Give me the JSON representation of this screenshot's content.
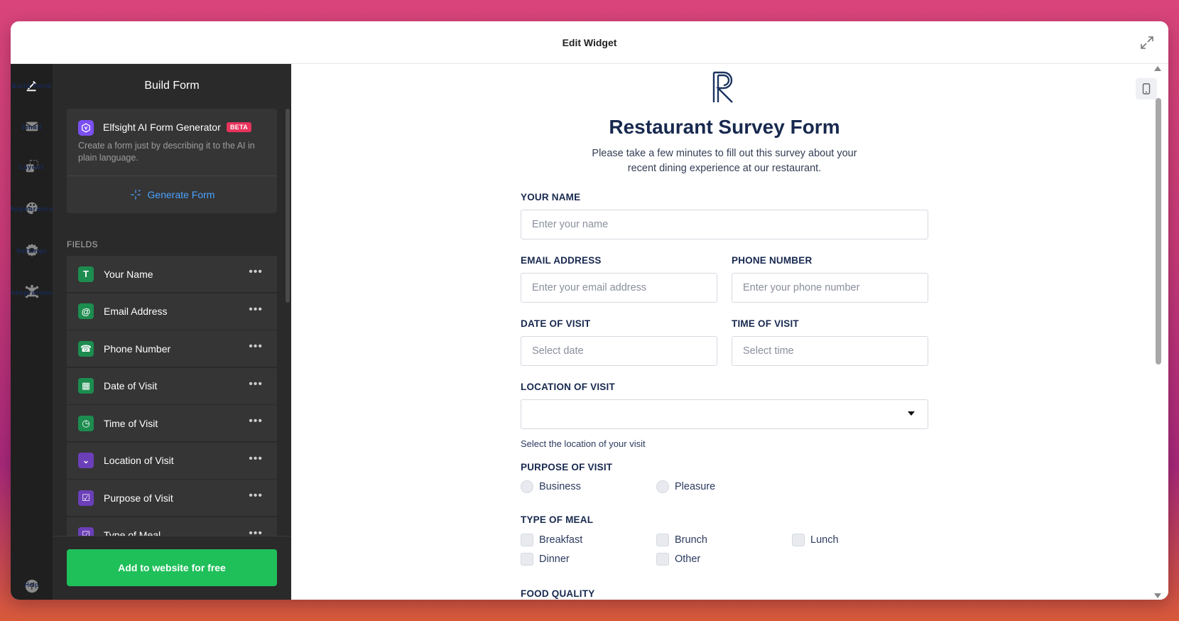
{
  "window": {
    "title": "Edit Widget"
  },
  "rail": {
    "items": [
      {
        "label": "Build Form",
        "icon": "pencil-icon"
      },
      {
        "label": "Email",
        "icon": "envelope-icon"
      },
      {
        "label": "Layout",
        "icon": "layout-icon"
      },
      {
        "label": "Appearance",
        "icon": "palette-icon"
      },
      {
        "label": "Settings",
        "icon": "gear-icon"
      },
      {
        "label": "Integrations",
        "icon": "integrations-icon"
      }
    ],
    "help_label": "Help"
  },
  "sidebar": {
    "title": "Build Form",
    "ai": {
      "name": "Elfsight AI Form Generator",
      "badge": "BETA",
      "description": "Create a form just by describing it to the AI in plain language.",
      "generate_label": "Generate Form"
    },
    "fields_label": "FIELDS",
    "fields": [
      {
        "name": "Your Name",
        "icon_glyph": "T",
        "color": "#1c8c4f"
      },
      {
        "name": "Email Address",
        "icon_glyph": "@",
        "color": "#1c8c4f"
      },
      {
        "name": "Phone Number",
        "icon_glyph": "☎",
        "color": "#1c8c4f"
      },
      {
        "name": "Date of Visit",
        "icon_glyph": "▦",
        "color": "#1c8c4f"
      },
      {
        "name": "Time of Visit",
        "icon_glyph": "◷",
        "color": "#1c8c4f"
      },
      {
        "name": "Location of Visit",
        "icon_glyph": "⌄",
        "color": "#6b3fb8"
      },
      {
        "name": "Purpose of Visit",
        "icon_glyph": "☑",
        "color": "#6b3fb8"
      },
      {
        "name": "Type of Meal",
        "icon_glyph": "☑",
        "color": "#6b3fb8"
      }
    ],
    "cta_label": "Add to website for free"
  },
  "form": {
    "title": "Restaurant Survey Form",
    "description": "Please take a few minutes to fill out this survey about your recent dining experience at our restaurant.",
    "your_name": {
      "label": "YOUR NAME",
      "placeholder": "Enter your name"
    },
    "email": {
      "label": "EMAIL ADDRESS",
      "placeholder": "Enter your email address"
    },
    "phone": {
      "label": "PHONE NUMBER",
      "placeholder": "Enter your phone number"
    },
    "date": {
      "label": "DATE OF VISIT",
      "placeholder": "Select date"
    },
    "time": {
      "label": "TIME OF VISIT",
      "placeholder": "Select time"
    },
    "location": {
      "label": "LOCATION OF VISIT",
      "value": "",
      "hint": "Select the location of your visit"
    },
    "purpose": {
      "label": "PURPOSE OF VISIT",
      "options": [
        "Business",
        "Pleasure"
      ]
    },
    "meal": {
      "label": "TYPE OF MEAL",
      "options": [
        "Breakfast",
        "Brunch",
        "Lunch",
        "Dinner",
        "Other"
      ]
    },
    "food_quality": {
      "label": "FOOD QUALITY"
    }
  },
  "colors": {
    "accent_green": "#1fbf5a",
    "link_blue": "#4aa3ff",
    "beta_badge": "#e8335c",
    "form_title": "#18294f"
  }
}
